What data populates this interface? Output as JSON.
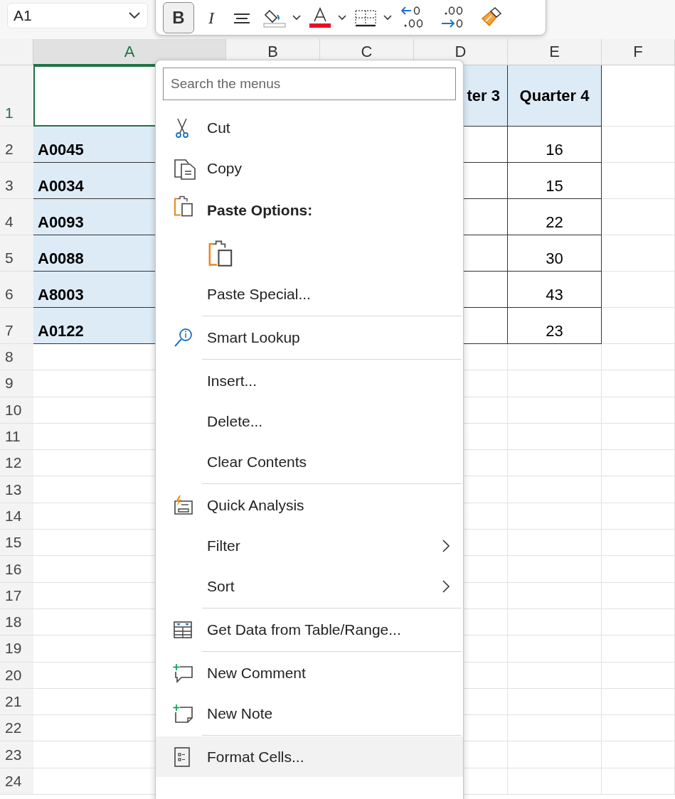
{
  "name_box": {
    "value": "A1"
  },
  "mini_toolbar": {
    "buttons": [
      {
        "kind": "bold",
        "label": "B",
        "selected": true,
        "has_dropdown": false
      },
      {
        "kind": "italic",
        "label": "I",
        "selected": false,
        "has_dropdown": false
      },
      {
        "kind": "align",
        "selected": false,
        "has_dropdown": false
      },
      {
        "kind": "fill-color",
        "selected": false,
        "has_dropdown": true
      },
      {
        "kind": "font-color",
        "selected": false,
        "has_dropdown": true
      },
      {
        "kind": "borders",
        "selected": false,
        "has_dropdown": true
      },
      {
        "kind": "decrease-decimal",
        "selected": false,
        "has_dropdown": false
      },
      {
        "kind": "increase-decimal",
        "selected": false,
        "has_dropdown": false
      },
      {
        "kind": "format-painter",
        "selected": false,
        "has_dropdown": false
      }
    ]
  },
  "sheet": {
    "columns": [
      {
        "label": "A",
        "selected": true
      },
      {
        "label": "B",
        "selected": false
      },
      {
        "label": "C",
        "selected": false
      },
      {
        "label": "D",
        "selected": false
      },
      {
        "label": "E",
        "selected": false
      },
      {
        "label": "F",
        "selected": false
      }
    ],
    "rows": [
      {
        "number": "1",
        "kind": "header",
        "selected": true,
        "column_d": "ter 3",
        "column_e": "Quarter 4"
      },
      {
        "number": "2",
        "kind": "data",
        "selected": false,
        "column_a": "A0045",
        "column_e": "16"
      },
      {
        "number": "3",
        "kind": "data",
        "selected": false,
        "column_a": "A0034",
        "column_e": "15"
      },
      {
        "number": "4",
        "kind": "data",
        "selected": false,
        "column_a": "A0093",
        "column_e": "22"
      },
      {
        "number": "5",
        "kind": "data",
        "selected": false,
        "column_a": "A0088",
        "column_e": "30"
      },
      {
        "number": "6",
        "kind": "data",
        "selected": false,
        "column_a": "A8003",
        "column_e": "43"
      },
      {
        "number": "7",
        "kind": "data",
        "selected": false,
        "column_a": "A0122",
        "column_e": "23"
      },
      {
        "number": "8",
        "kind": "empty",
        "selected": false
      },
      {
        "number": "9",
        "kind": "empty",
        "selected": false
      },
      {
        "number": "10",
        "kind": "empty",
        "selected": false
      },
      {
        "number": "11",
        "kind": "empty",
        "selected": false
      },
      {
        "number": "12",
        "kind": "empty",
        "selected": false
      },
      {
        "number": "13",
        "kind": "empty",
        "selected": false
      },
      {
        "number": "14",
        "kind": "empty",
        "selected": false
      },
      {
        "number": "15",
        "kind": "empty",
        "selected": false
      },
      {
        "number": "16",
        "kind": "empty",
        "selected": false
      },
      {
        "number": "17",
        "kind": "empty",
        "selected": false
      },
      {
        "number": "18",
        "kind": "empty",
        "selected": false
      },
      {
        "number": "19",
        "kind": "empty",
        "selected": false
      },
      {
        "number": "20",
        "kind": "empty",
        "selected": false
      },
      {
        "number": "21",
        "kind": "empty",
        "selected": false
      },
      {
        "number": "22",
        "kind": "empty",
        "selected": false
      },
      {
        "number": "23",
        "kind": "empty",
        "selected": false
      },
      {
        "number": "24",
        "kind": "empty",
        "selected": false
      }
    ]
  },
  "context_menu": {
    "search": {
      "placeholder": "Search the menus"
    },
    "items": [
      {
        "kind": "item",
        "label": "Cut",
        "separator_before": false,
        "has_submenu": false,
        "hovered": false
      },
      {
        "kind": "item",
        "label": "Copy",
        "separator_before": false,
        "has_submenu": false,
        "hovered": false
      },
      {
        "kind": "heading",
        "label": "Paste Options:",
        "separator_before": false
      },
      {
        "kind": "paste-button",
        "separator_before": false
      },
      {
        "kind": "item",
        "label": "Paste Special...",
        "separator_before": false,
        "has_submenu": false,
        "hovered": false
      },
      {
        "kind": "item",
        "label": "Smart Lookup",
        "separator_before": true,
        "has_submenu": false,
        "hovered": false
      },
      {
        "kind": "item",
        "label": "Insert...",
        "separator_before": true,
        "has_submenu": false,
        "hovered": false
      },
      {
        "kind": "item",
        "label": "Delete...",
        "separator_before": false,
        "has_submenu": false,
        "hovered": false
      },
      {
        "kind": "item",
        "label": "Clear Contents",
        "separator_before": false,
        "has_submenu": false,
        "hovered": false
      },
      {
        "kind": "item",
        "label": "Quick Analysis",
        "separator_before": true,
        "has_submenu": false,
        "hovered": false
      },
      {
        "kind": "item",
        "label": "Filter",
        "separator_before": false,
        "has_submenu": true,
        "hovered": false
      },
      {
        "kind": "item",
        "label": "Sort",
        "separator_before": false,
        "has_submenu": true,
        "hovered": false
      },
      {
        "kind": "item",
        "label": "Get Data from Table/Range...",
        "separator_before": true,
        "has_submenu": false,
        "hovered": false
      },
      {
        "kind": "item",
        "label": "New Comment",
        "separator_before": true,
        "has_submenu": false,
        "hovered": false
      },
      {
        "kind": "item",
        "label": "New Note",
        "separator_before": false,
        "has_submenu": false,
        "hovered": false
      },
      {
        "kind": "item",
        "label": "Format Cells...",
        "separator_before": true,
        "has_submenu": false,
        "hovered": true
      }
    ]
  }
}
